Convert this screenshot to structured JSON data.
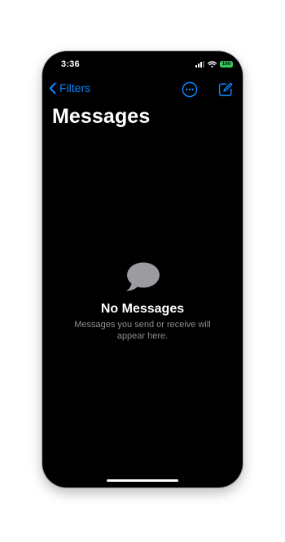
{
  "status_bar": {
    "time": "3:36",
    "battery": "100"
  },
  "nav": {
    "back_label": "Filters"
  },
  "page": {
    "title": "Messages"
  },
  "empty_state": {
    "title": "No Messages",
    "subtitle": "Messages you send or receive will appear here."
  },
  "icons": {
    "back": "chevron-left-icon",
    "more": "ellipsis-circle-icon",
    "compose": "compose-icon",
    "empty": "speech-bubble-icon"
  },
  "colors": {
    "background": "#000000",
    "accent": "#0a84ff",
    "battery": "#34c759",
    "secondary_text": "#8e8e93",
    "bubble": "#9b9ba1"
  }
}
